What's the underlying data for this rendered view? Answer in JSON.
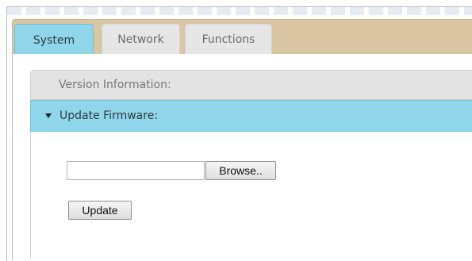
{
  "tabs": [
    {
      "label": "System",
      "active": true
    },
    {
      "label": "Network",
      "active": false
    },
    {
      "label": "Functions",
      "active": false
    }
  ],
  "sections": {
    "version": {
      "label": "Version Information:",
      "expanded": false
    },
    "firmware": {
      "label": "Update Firmware:",
      "expanded": true
    }
  },
  "firmware_form": {
    "file_value": "",
    "browse_label": "Browse..",
    "update_label": "Update"
  },
  "colors": {
    "tabbar_bg": "#dbc6a3",
    "active_accent": "#8fd6ea",
    "inactive_tab": "#e6e6e6"
  }
}
